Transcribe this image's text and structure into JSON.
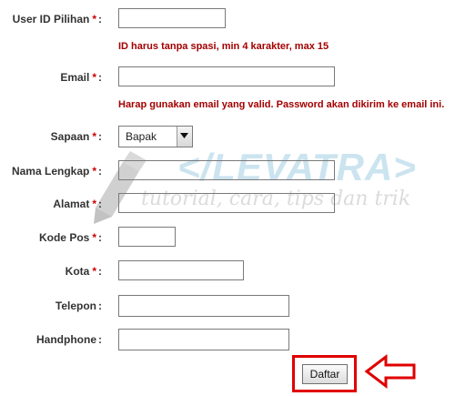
{
  "form": {
    "userid": {
      "label": "User ID Pilihan",
      "req": "*",
      "colon": ":",
      "value": "",
      "hint": "ID harus tanpa spasi, min 4 karakter, max 15"
    },
    "email": {
      "label": "Email",
      "req": "*",
      "colon": ":",
      "value": "",
      "hint": "Harap gunakan email yang valid. Password akan dikirim ke email ini."
    },
    "sapaan": {
      "label": "Sapaan",
      "req": "*",
      "colon": ":",
      "selected": "Bapak"
    },
    "nama": {
      "label": "Nama Lengkap",
      "req": "*",
      "colon": ":",
      "value": ""
    },
    "alamat": {
      "label": "Alamat",
      "req": "*",
      "colon": ":",
      "value": ""
    },
    "kodepos": {
      "label": "Kode Pos",
      "req": "*",
      "colon": ":",
      "value": ""
    },
    "kota": {
      "label": "Kota",
      "req": "*",
      "colon": ":",
      "value": ""
    },
    "telepon": {
      "label": "Telepon",
      "colon": ":",
      "value": ""
    },
    "handphone": {
      "label": "Handphone",
      "colon": ":",
      "value": ""
    },
    "submit_label": "Daftar"
  },
  "watermark": {
    "logo_text": "</LEVATRA>",
    "tagline": "tutorial, cara, tips dan trik"
  },
  "colors": {
    "required": "#cc0000",
    "hint": "#a30000",
    "highlight": "#e00000"
  }
}
